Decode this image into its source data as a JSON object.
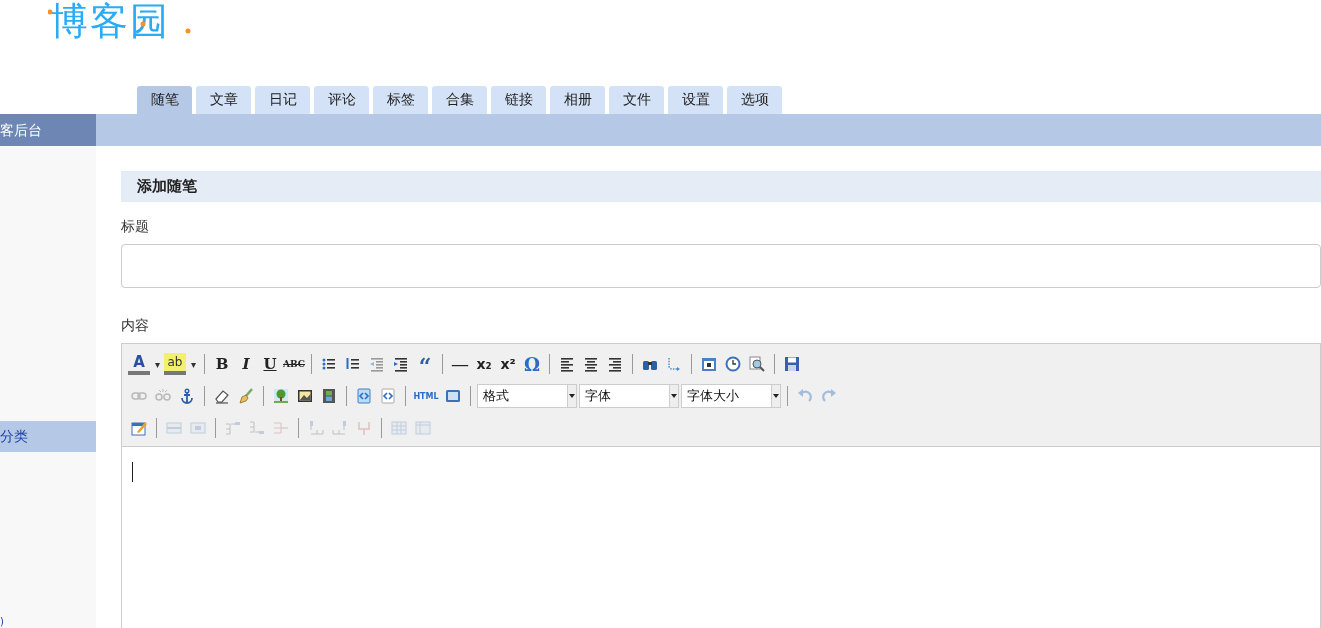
{
  "logo": "博客园",
  "tabs": [
    {
      "label": "随笔",
      "selected": true
    },
    {
      "label": "文章",
      "selected": false
    },
    {
      "label": "日记",
      "selected": false
    },
    {
      "label": "评论",
      "selected": false
    },
    {
      "label": "标签",
      "selected": false
    },
    {
      "label": "合集",
      "selected": false
    },
    {
      "label": "链接",
      "selected": false
    },
    {
      "label": "相册",
      "selected": false
    },
    {
      "label": "文件",
      "selected": false
    },
    {
      "label": "设置",
      "selected": false
    },
    {
      "label": "选项",
      "selected": false
    }
  ],
  "sidebar": {
    "header": "客后台",
    "section": "分类",
    "footer": ")"
  },
  "section_title": "添加随笔",
  "title_label": "标题",
  "content_label": "内容",
  "toolbar": [
    [
      {
        "kind": "glyph",
        "text": "A",
        "disabled": false
      },
      {
        "kind": "caret",
        "text": "▾",
        "disabled": false
      },
      {
        "kind": "glyph",
        "text": "ab",
        "disabled": false
      },
      {
        "kind": "caret",
        "text": "▾",
        "disabled": false
      },
      {
        "kind": "sep"
      },
      {
        "kind": "glyph",
        "text": "B",
        "disabled": false
      },
      {
        "kind": "glyph",
        "text": "I",
        "disabled": false
      },
      {
        "kind": "glyph",
        "text": "U",
        "disabled": false
      },
      {
        "kind": "glyph",
        "text": "ABC",
        "disabled": false
      },
      {
        "kind": "sep"
      },
      {
        "kind": "icon",
        "disabled": false
      },
      {
        "kind": "icon",
        "disabled": false
      },
      {
        "kind": "icon",
        "disabled": true
      },
      {
        "kind": "icon",
        "disabled": false
      },
      {
        "kind": "glyph",
        "text": "“",
        "disabled": false
      },
      {
        "kind": "sep"
      },
      {
        "kind": "glyph",
        "text": "—",
        "disabled": false
      },
      {
        "kind": "glyph",
        "text": "x₂",
        "disabled": false
      },
      {
        "kind": "glyph",
        "text": "x²",
        "disabled": false
      },
      {
        "kind": "glyph",
        "text": "Ω",
        "disabled": false
      },
      {
        "kind": "sep"
      },
      {
        "kind": "icon",
        "disabled": false
      },
      {
        "kind": "icon",
        "disabled": false
      },
      {
        "kind": "icon",
        "disabled": false
      },
      {
        "kind": "sep"
      },
      {
        "kind": "icon",
        "disabled": false
      },
      {
        "kind": "icon",
        "disabled": false
      },
      {
        "kind": "sep"
      },
      {
        "kind": "icon",
        "disabled": false
      },
      {
        "kind": "icon",
        "disabled": false
      },
      {
        "kind": "icon",
        "disabled": false
      },
      {
        "kind": "sep"
      },
      {
        "kind": "icon",
        "disabled": false
      }
    ],
    [
      {
        "kind": "icon",
        "disabled": true
      },
      {
        "kind": "icon",
        "disabled": true
      },
      {
        "kind": "icon",
        "disabled": false
      },
      {
        "kind": "sep"
      },
      {
        "kind": "icon",
        "disabled": false
      },
      {
        "kind": "icon",
        "disabled": false
      },
      {
        "kind": "sep"
      },
      {
        "kind": "icon",
        "disabled": false
      },
      {
        "kind": "icon",
        "disabled": false
      },
      {
        "kind": "icon",
        "disabled": false
      },
      {
        "kind": "sep"
      },
      {
        "kind": "icon",
        "disabled": false
      },
      {
        "kind": "icon",
        "disabled": false
      },
      {
        "kind": "sep"
      },
      {
        "kind": "glyph",
        "text": "HTML",
        "disabled": false
      },
      {
        "kind": "icon",
        "disabled": false
      },
      {
        "kind": "sep"
      },
      {
        "kind": "select",
        "text": "格式"
      },
      {
        "kind": "select",
        "text": "字体"
      },
      {
        "kind": "select",
        "text": "字体大小"
      },
      {
        "kind": "sep"
      },
      {
        "kind": "icon",
        "disabled": true
      },
      {
        "kind": "icon",
        "disabled": true
      }
    ],
    [
      {
        "kind": "icon",
        "disabled": false
      },
      {
        "kind": "sep"
      },
      {
        "kind": "icon",
        "disabled": true
      },
      {
        "kind": "icon",
        "disabled": true
      },
      {
        "kind": "sep"
      },
      {
        "kind": "icon",
        "disabled": true
      },
      {
        "kind": "icon",
        "disabled": true
      },
      {
        "kind": "icon",
        "disabled": true
      },
      {
        "kind": "sep"
      },
      {
        "kind": "icon",
        "disabled": true
      },
      {
        "kind": "icon",
        "disabled": true
      },
      {
        "kind": "icon",
        "disabled": true
      },
      {
        "kind": "sep"
      },
      {
        "kind": "icon",
        "disabled": true
      },
      {
        "kind": "icon",
        "disabled": true
      }
    ]
  ]
}
